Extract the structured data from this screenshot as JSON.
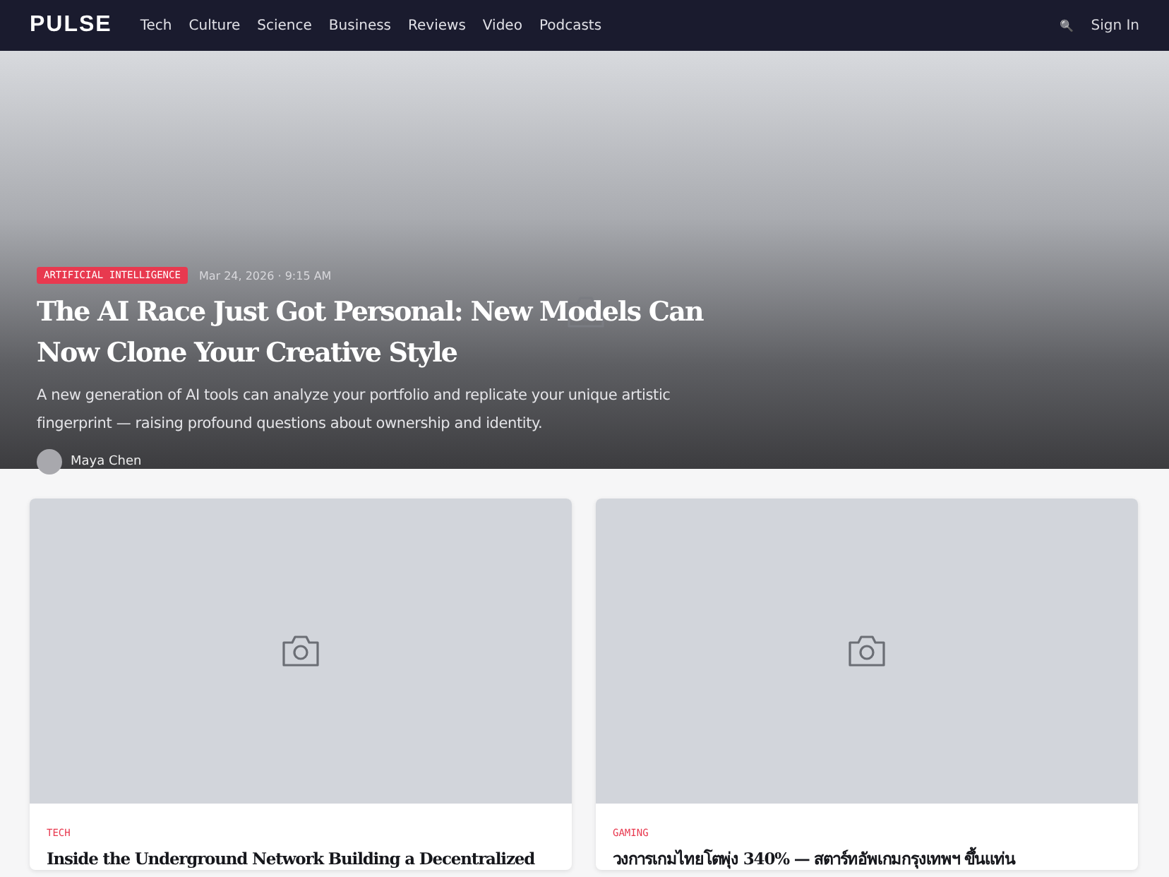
{
  "nav": {
    "logo": "PULSE",
    "links": [
      "Tech",
      "Culture",
      "Science",
      "Business",
      "Reviews",
      "Video",
      "Podcasts"
    ],
    "search_icon": "🔍",
    "sign_in": "Sign In"
  },
  "hero": {
    "category": "ARTIFICIAL INTELLIGENCE",
    "date": "Mar 24, 2026 · 9:15 AM",
    "title": "The AI Race Just Got Personal: New Models Can Now Clone Your Creative Style",
    "summary": "A new generation of AI tools can analyze your portfolio and replicate your unique artistic fingerprint — raising profound questions about ownership and identity.",
    "author": "Maya Chen"
  },
  "cards": [
    {
      "category": "TECH",
      "title": "Inside the Underground Network Building a Decentralized"
    },
    {
      "category": "GAMING",
      "title": "วงการเกมไทยโตพุ่ง 340% — สตาร์ทอัพเกมกรุงเทพฯ ขึ้นแท่น"
    }
  ]
}
